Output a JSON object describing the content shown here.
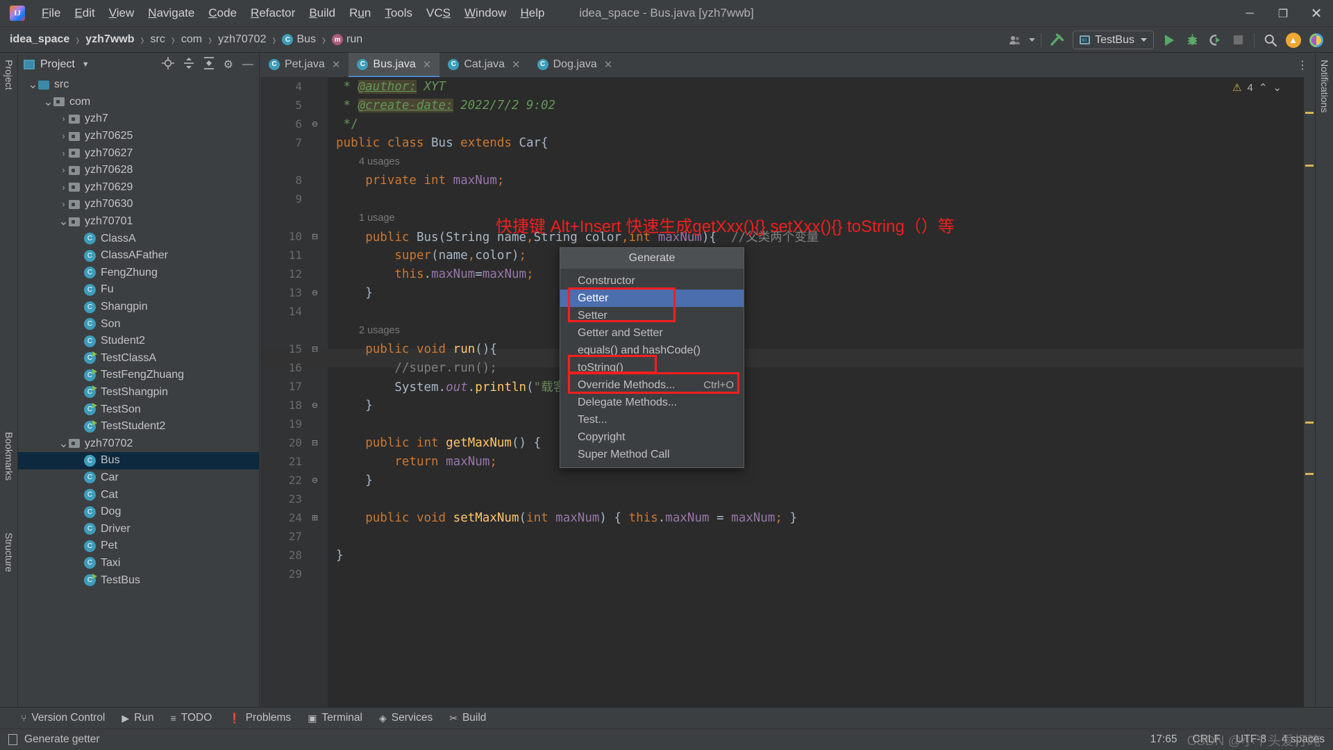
{
  "titlebar": {
    "logo_text": "IJ",
    "window_title": "idea_space - Bus.java [yzh7wwb]",
    "menus": [
      {
        "label": "File",
        "mnemonic": "F"
      },
      {
        "label": "Edit",
        "mnemonic": "E"
      },
      {
        "label": "View",
        "mnemonic": "V"
      },
      {
        "label": "Navigate",
        "mnemonic": "N"
      },
      {
        "label": "Code",
        "mnemonic": "C"
      },
      {
        "label": "Refactor",
        "mnemonic": "R"
      },
      {
        "label": "Build",
        "mnemonic": "B"
      },
      {
        "label": "Run",
        "mnemonic": "u"
      },
      {
        "label": "Tools",
        "mnemonic": "T"
      },
      {
        "label": "VCS",
        "mnemonic": "S"
      },
      {
        "label": "Window",
        "mnemonic": "W"
      },
      {
        "label": "Help",
        "mnemonic": "H"
      }
    ],
    "minimize": "─",
    "maximize": "❐",
    "close": "✕"
  },
  "navbar": {
    "breadcrumbs": [
      {
        "label": "idea_space",
        "icon": "",
        "bold": true
      },
      {
        "label": "yzh7wwb",
        "icon": "",
        "bold": true
      },
      {
        "label": "src",
        "icon": "",
        "bold": false
      },
      {
        "label": "com",
        "icon": "",
        "bold": false
      },
      {
        "label": "yzh70702",
        "icon": "",
        "bold": false
      },
      {
        "label": "Bus",
        "icon": "class-badge",
        "bold": false
      },
      {
        "label": "run",
        "icon": "method-badge",
        "bold": false
      }
    ],
    "separator": "›",
    "run_config": "TestBus",
    "icons": {
      "account": "account-icon",
      "build_hammer": "hammer-icon",
      "run": "run-icon",
      "debug": "debug-icon",
      "run_coverage": "run-with-coverage-icon",
      "stop": "stop-icon",
      "search": "search-icon",
      "update": "update-icon",
      "plugin": "plugin-icon"
    }
  },
  "left_strip": {
    "project_label": "Project",
    "bookmarks_label": "Bookmarks",
    "structure_label": "Structure"
  },
  "right_strip": {
    "notifications_label": "Notifications"
  },
  "project_panel": {
    "title": "Project",
    "tools": [
      "locate-icon",
      "expand-all-icon",
      "collapse-all-icon",
      "settings-icon",
      "hide-icon"
    ],
    "tree": [
      {
        "label": "src",
        "depth": 1,
        "type": "folder-src",
        "twist": "⌄",
        "selected": false
      },
      {
        "label": "com",
        "depth": 2,
        "type": "folder",
        "twist": "⌄",
        "selected": false
      },
      {
        "label": "yzh7",
        "depth": 3,
        "type": "folder",
        "twist": "›",
        "selected": false
      },
      {
        "label": "yzh70625",
        "depth": 3,
        "type": "folder",
        "twist": "›",
        "selected": false
      },
      {
        "label": "yzh70627",
        "depth": 3,
        "type": "folder",
        "twist": "›",
        "selected": false
      },
      {
        "label": "yzh70628",
        "depth": 3,
        "type": "folder",
        "twist": "›",
        "selected": false
      },
      {
        "label": "yzh70629",
        "depth": 3,
        "type": "folder",
        "twist": "›",
        "selected": false
      },
      {
        "label": "yzh70630",
        "depth": 3,
        "type": "folder",
        "twist": "›",
        "selected": false
      },
      {
        "label": "yzh70701",
        "depth": 3,
        "type": "folder",
        "twist": "⌄",
        "selected": false
      },
      {
        "label": "ClassA",
        "depth": 4,
        "type": "class",
        "twist": "",
        "selected": false
      },
      {
        "label": "ClassAFather",
        "depth": 4,
        "type": "class",
        "twist": "",
        "selected": false
      },
      {
        "label": "FengZhung",
        "depth": 4,
        "type": "class",
        "twist": "",
        "selected": false
      },
      {
        "label": "Fu",
        "depth": 4,
        "type": "class",
        "twist": "",
        "selected": false
      },
      {
        "label": "Shangpin",
        "depth": 4,
        "type": "class",
        "twist": "",
        "selected": false
      },
      {
        "label": "Son",
        "depth": 4,
        "type": "class",
        "twist": "",
        "selected": false
      },
      {
        "label": "Student2",
        "depth": 4,
        "type": "class",
        "twist": "",
        "selected": false
      },
      {
        "label": "TestClassA",
        "depth": 4,
        "type": "class-runnable",
        "twist": "",
        "selected": false
      },
      {
        "label": "TestFengZhuang",
        "depth": 4,
        "type": "class-runnable",
        "twist": "",
        "selected": false
      },
      {
        "label": "TestShangpin",
        "depth": 4,
        "type": "class-runnable",
        "twist": "",
        "selected": false
      },
      {
        "label": "TestSon",
        "depth": 4,
        "type": "class-runnable",
        "twist": "",
        "selected": false
      },
      {
        "label": "TestStudent2",
        "depth": 4,
        "type": "class-runnable",
        "twist": "",
        "selected": false
      },
      {
        "label": "yzh70702",
        "depth": 3,
        "type": "folder",
        "twist": "⌄",
        "selected": false
      },
      {
        "label": "Bus",
        "depth": 4,
        "type": "class",
        "twist": "",
        "selected": true
      },
      {
        "label": "Car",
        "depth": 4,
        "type": "class",
        "twist": "",
        "selected": false
      },
      {
        "label": "Cat",
        "depth": 4,
        "type": "class",
        "twist": "",
        "selected": false
      },
      {
        "label": "Dog",
        "depth": 4,
        "type": "class",
        "twist": "",
        "selected": false
      },
      {
        "label": "Driver",
        "depth": 4,
        "type": "class",
        "twist": "",
        "selected": false
      },
      {
        "label": "Pet",
        "depth": 4,
        "type": "class",
        "twist": "",
        "selected": false
      },
      {
        "label": "Taxi",
        "depth": 4,
        "type": "class",
        "twist": "",
        "selected": false
      },
      {
        "label": "TestBus",
        "depth": 4,
        "type": "class-runnable",
        "twist": "",
        "selected": false
      }
    ]
  },
  "editor": {
    "tabs": [
      {
        "label": "Pet.java",
        "active": false
      },
      {
        "label": "Bus.java",
        "active": true
      },
      {
        "label": "Cat.java",
        "active": false
      },
      {
        "label": "Dog.java",
        "active": false
      }
    ],
    "close_glyph": "✕",
    "inspection": {
      "warning_count": "4",
      "up": "⌃",
      "down": "⌄"
    },
    "annotation": "快捷键 Alt+Insert 快速生成getXxx(){} setXxx(){} toString（）等",
    "lines": [
      {
        "n": "4",
        "text": " * @author: XYT"
      },
      {
        "n": "5",
        "text": " * @create-date: 2022/7/2 9:02"
      },
      {
        "n": "6",
        "text": " */"
      },
      {
        "n": "7",
        "text": "public class Bus extends Car{"
      },
      {
        "n": "",
        "text": "4 usages"
      },
      {
        "n": "8",
        "text": "    private int maxNum;"
      },
      {
        "n": "9",
        "text": ""
      },
      {
        "n": "",
        "text": "1 usage"
      },
      {
        "n": "10",
        "text": "    public Bus(String name,String color,int maxNum){  //父类两个变量"
      },
      {
        "n": "11",
        "text": "        super(name,color);"
      },
      {
        "n": "12",
        "text": "        this.maxNum=maxNum;"
      },
      {
        "n": "13",
        "text": "    }"
      },
      {
        "n": "14",
        "text": ""
      },
      {
        "n": "",
        "text": "2 usages"
      },
      {
        "n": "15",
        "text": "    public void run(){"
      },
      {
        "n": "16",
        "text": "        //super.run();"
      },
      {
        "n": "17",
        "text": "        System.out.println(\"载客量\"+maxNum+\"，下一站\");"
      },
      {
        "n": "18",
        "text": "    }"
      },
      {
        "n": "19",
        "text": ""
      },
      {
        "n": "20",
        "text": "    public int getMaxNum() {"
      },
      {
        "n": "21",
        "text": "        return maxNum;"
      },
      {
        "n": "22",
        "text": "    }"
      },
      {
        "n": "23",
        "text": ""
      },
      {
        "n": "24",
        "text": "    public void setMaxNum(int maxNum) { this.maxNum = maxNum; }"
      },
      {
        "n": "27",
        "text": ""
      },
      {
        "n": "28",
        "text": "}"
      },
      {
        "n": "29",
        "text": ""
      }
    ]
  },
  "generate_popup": {
    "title": "Generate",
    "items": [
      {
        "label": "Constructor",
        "shortcut": "",
        "selected": false,
        "highlight": false
      },
      {
        "label": "Getter",
        "shortcut": "",
        "selected": true,
        "highlight": true
      },
      {
        "label": "Setter",
        "shortcut": "",
        "selected": false,
        "highlight": true
      },
      {
        "label": "Getter and Setter",
        "shortcut": "",
        "selected": false,
        "highlight": false
      },
      {
        "label": "equals() and hashCode()",
        "shortcut": "",
        "selected": false,
        "highlight": false
      },
      {
        "label": "toString()",
        "shortcut": "",
        "selected": false,
        "highlight": true
      },
      {
        "label": "Override Methods...",
        "shortcut": "Ctrl+O",
        "selected": false,
        "highlight": true
      },
      {
        "label": "Delegate Methods...",
        "shortcut": "",
        "selected": false,
        "highlight": false
      },
      {
        "label": "Test...",
        "shortcut": "",
        "selected": false,
        "highlight": false
      },
      {
        "label": "Copyright",
        "shortcut": "",
        "selected": false,
        "highlight": false
      },
      {
        "label": "Super Method Call",
        "shortcut": "",
        "selected": false,
        "highlight": false
      }
    ]
  },
  "bottom_bar": {
    "windows": [
      {
        "label": "Version Control",
        "icon": "branch-icon"
      },
      {
        "label": "Run",
        "icon": "run-icon"
      },
      {
        "label": "TODO",
        "icon": "list-icon"
      },
      {
        "label": "Problems",
        "icon": "problems-icon"
      },
      {
        "label": "Terminal",
        "icon": "terminal-icon"
      },
      {
        "label": "Services",
        "icon": "services-icon"
      },
      {
        "label": "Build",
        "icon": "build-icon"
      }
    ]
  },
  "status_bar": {
    "message": "Generate getter",
    "caret_position": "17:65",
    "line_separator": "CRLF",
    "encoding": "UTF-8",
    "indent": "4 spaces",
    "watermark": "CSDN @小丫头爱打盹"
  },
  "colors": {
    "accent": "#4b6eaf",
    "highlight_red": "#ff1e1e",
    "annotation_red": "#f01f1f",
    "editor_bg": "#2b2b2b",
    "chrome_bg": "#3c3f41",
    "selection_blue": "#0d293e"
  }
}
